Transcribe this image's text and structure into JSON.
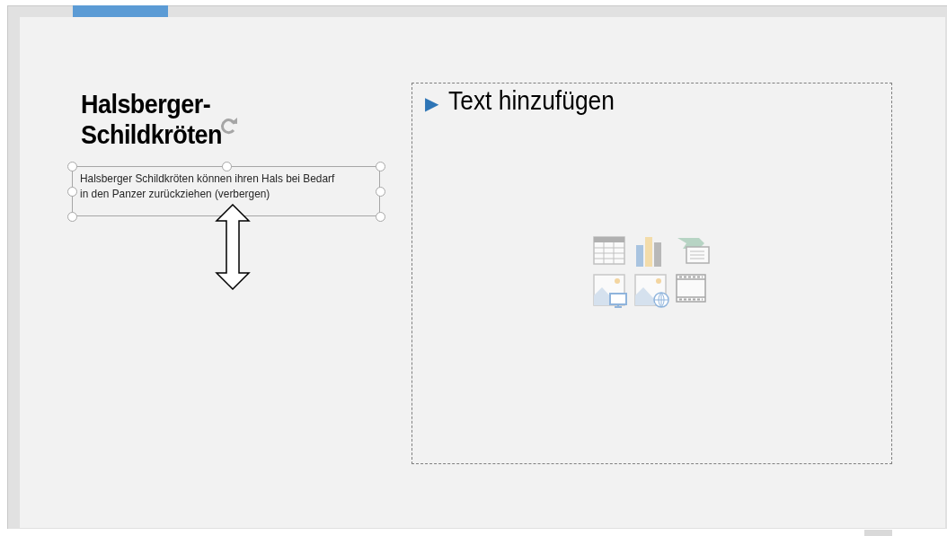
{
  "slide": {
    "title": "Halsberger-\nSchildkröten",
    "text_box": {
      "text": "Halsberger Schildkröten können ihren Hals bei Bedarf in den Panzer zurückziehen (verbergen)",
      "selected": true
    },
    "content_placeholder": {
      "bullet": "▶",
      "prompt": "Text hinzufügen"
    }
  }
}
